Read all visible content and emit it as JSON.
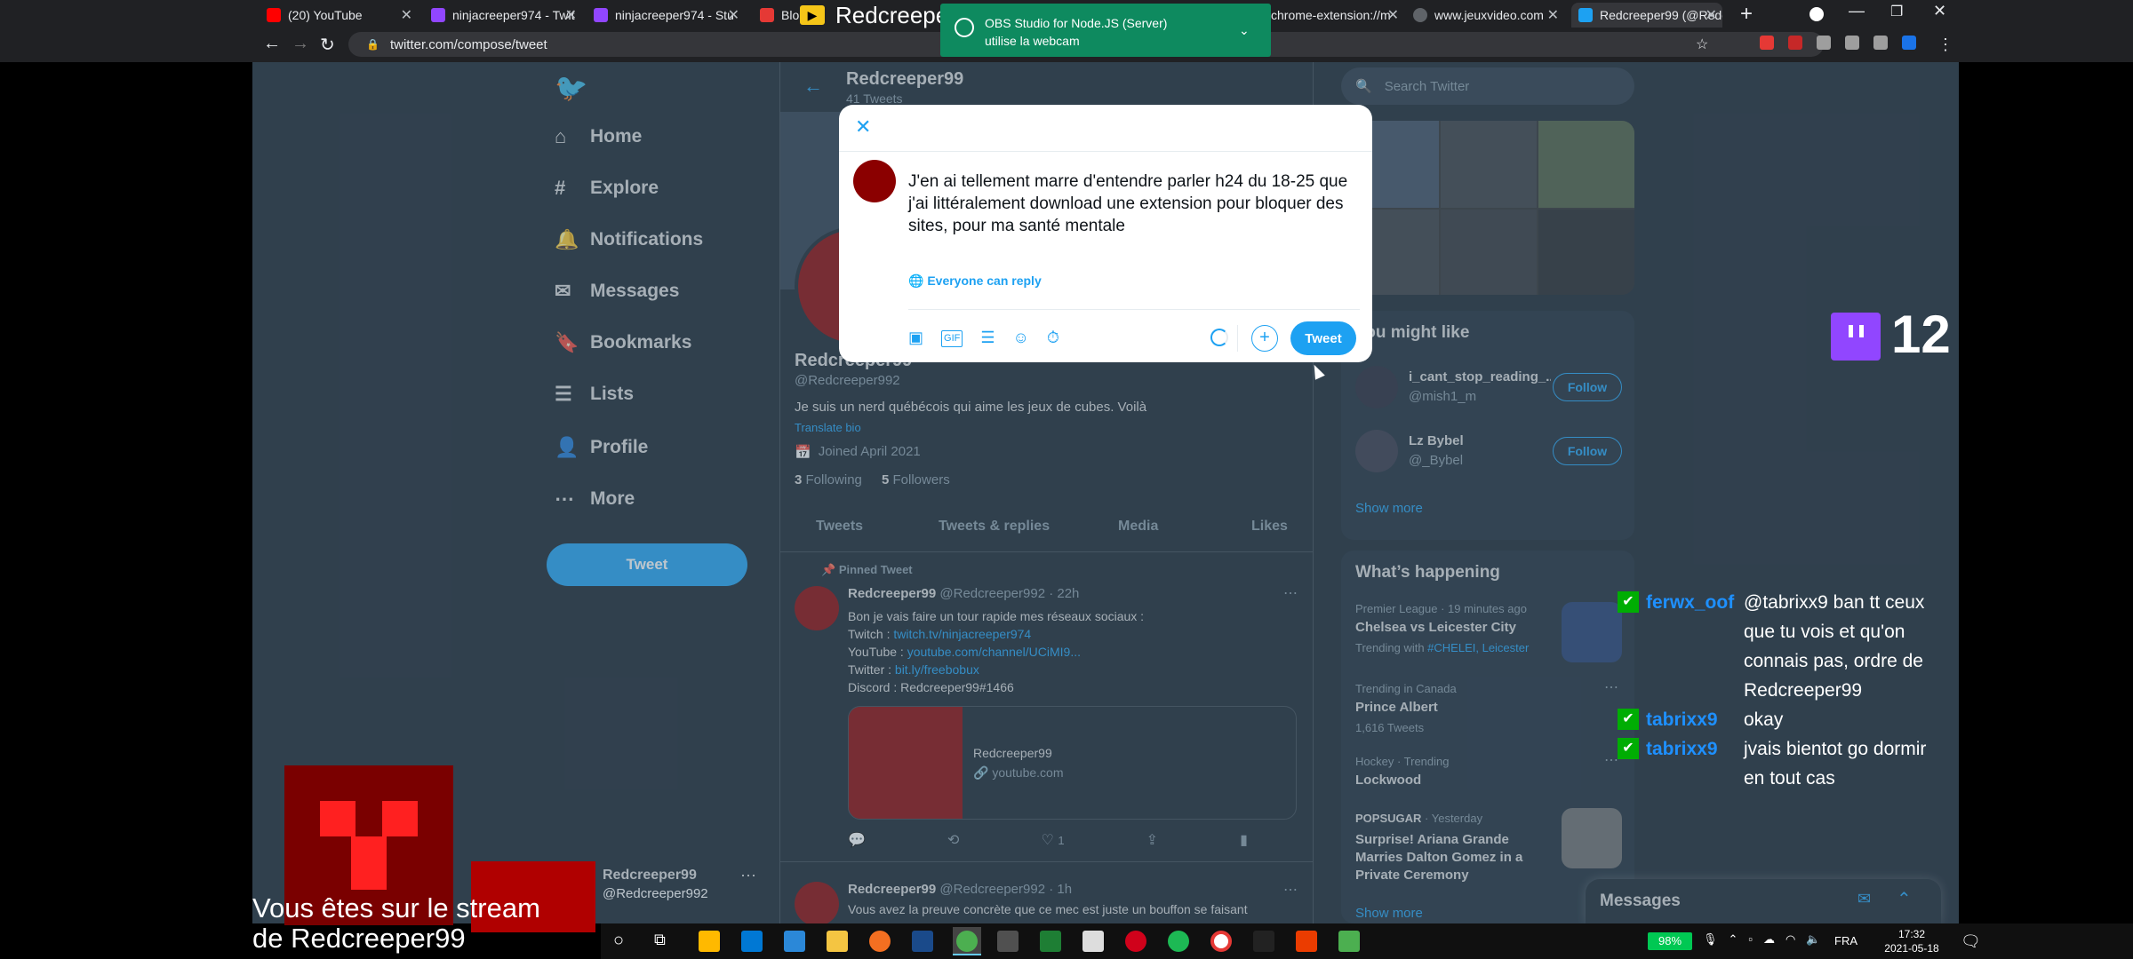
{
  "browser": {
    "tabs": [
      {
        "label": "(20) YouTube",
        "color": "#ff0000"
      },
      {
        "label": "ninjacreeper974 - Twit",
        "color": "#9146ff"
      },
      {
        "label": "ninjacreeper974 - Stu",
        "color": "#9146ff"
      },
      {
        "label": "Blo",
        "color": "#e53935"
      },
      {
        "label": "chrome-extension://m",
        "color": "#5f6368"
      },
      {
        "label": "www.jeuxvideo.com",
        "color": "#5f6368"
      },
      {
        "label": "Redcreeper99 (@Redc",
        "color": "#1da1f2"
      }
    ],
    "url": "twitter.com/compose/tweet",
    "new_tab": "+"
  },
  "obs": {
    "title": "OBS Studio for Node.JS (Server)",
    "subtitle": "utilise la webcam",
    "overlay_name": "Redcreeper99"
  },
  "sidebar": {
    "items": [
      {
        "label": "Home",
        "icon": "home-icon"
      },
      {
        "label": "Explore",
        "icon": "hash-icon"
      },
      {
        "label": "Notifications",
        "icon": "bell-icon"
      },
      {
        "label": "Messages",
        "icon": "mail-icon"
      },
      {
        "label": "Bookmarks",
        "icon": "bookmark-icon"
      },
      {
        "label": "Lists",
        "icon": "list-icon"
      },
      {
        "label": "Profile",
        "icon": "person-icon"
      },
      {
        "label": "More",
        "icon": "more-icon"
      }
    ],
    "tweet_button": "Tweet",
    "account_name": "Redcreeper99",
    "account_handle": "@Redcreeper992"
  },
  "profile": {
    "name": "Redcreeper99",
    "tweet_count": "41 Tweets",
    "display_name": "Redcreeper99",
    "handle": "@Redcreeper992",
    "bio": "Je suis un nerd québécois qui aime les jeux de cubes. Voilà",
    "translate": "Translate bio",
    "joined": "Joined April 2021",
    "following_count": "3",
    "following_label": "Following",
    "followers_count": "5",
    "followers_label": "Followers",
    "tabs": [
      "Tweets",
      "Tweets & replies",
      "Media",
      "Likes"
    ]
  },
  "feed": {
    "pinned_label": "Pinned Tweet",
    "tweet1": {
      "name": "Redcreeper99",
      "meta": "@Redcreeper992 · 22h",
      "lines": [
        {
          "text": "Bon je vais faire un tour rapide mes réseaux sociaux :",
          "link": ""
        },
        {
          "text": "Twitch : ",
          "link": "twitch.tv/ninjacreeper974"
        },
        {
          "text": "YouTube : ",
          "link": "youtube.com/channel/UCiMI9..."
        },
        {
          "text": "Twitter : ",
          "link": "bit.ly/freebobux"
        },
        {
          "text": "Discord : Redcreeper99#1466",
          "link": ""
        }
      ],
      "card_title": "Redcreeper99",
      "card_domain": "youtube.com",
      "likes": "1"
    },
    "tweet2": {
      "name": "Redcreeper99",
      "meta": "@Redcreeper992 · 1h",
      "text": "Vous avez la preuve concrète que ce mec est juste un bouffon se faisant"
    }
  },
  "compose": {
    "text": "J'en ai tellement marre d'entendre parler h24 du 18-25 que j'ai littéralement download une extension pour bloquer des sites, pour ma santé mentale",
    "reply_setting": "Everyone can reply",
    "tweet_button": "Tweet"
  },
  "right": {
    "search_placeholder": "Search Twitter",
    "suggest_title": "You might like",
    "suggestions": [
      {
        "name": "i_cant_stop_reading_...",
        "handle": "@mish1_m",
        "button": "Follow"
      },
      {
        "name": "Lz Bybel",
        "handle": "@_Bybel",
        "button": "Follow"
      }
    ],
    "show_more": "Show more",
    "happening_title": "What’s happening",
    "trends": [
      {
        "meta": "Premier League · 19 minutes ago",
        "title": "Chelsea vs Leicester City",
        "sub": "Trending with ",
        "sub_link": "#CHELEI, Leicester"
      },
      {
        "meta": "Trending in Canada",
        "title": "Prince Albert",
        "sub": "1,616 Tweets",
        "sub_link": ""
      },
      {
        "meta": "Hockey · Trending",
        "title": "Lockwood",
        "sub": "",
        "sub_link": ""
      }
    ],
    "news_source": "POPSUGAR",
    "news_time": "· Yesterday",
    "news_title": "Surprise! Ariana Grande Marries Dalton Gomez in a Private Ceremony",
    "show_more_bottom": "Show more",
    "messages": "Messages"
  },
  "stream": {
    "viewer_count": "12",
    "chat": [
      {
        "user": "ferwx_oof",
        "message": "@tabrixx9 ban tt ceux que tu vois et qu'on connais pas, ordre de Redcreeper99"
      },
      {
        "user": "tabrixx9",
        "message": "okay"
      },
      {
        "user": "tabrixx9",
        "message": "jvais bientot go dormir en tout cas"
      }
    ],
    "caption_line1": "Vous êtes sur le stream",
    "caption_line2": "de Redcreeper99"
  },
  "taskbar": {
    "battery": "98%",
    "lang": "FRA",
    "time": "17:32",
    "date": "2021-05-18"
  }
}
